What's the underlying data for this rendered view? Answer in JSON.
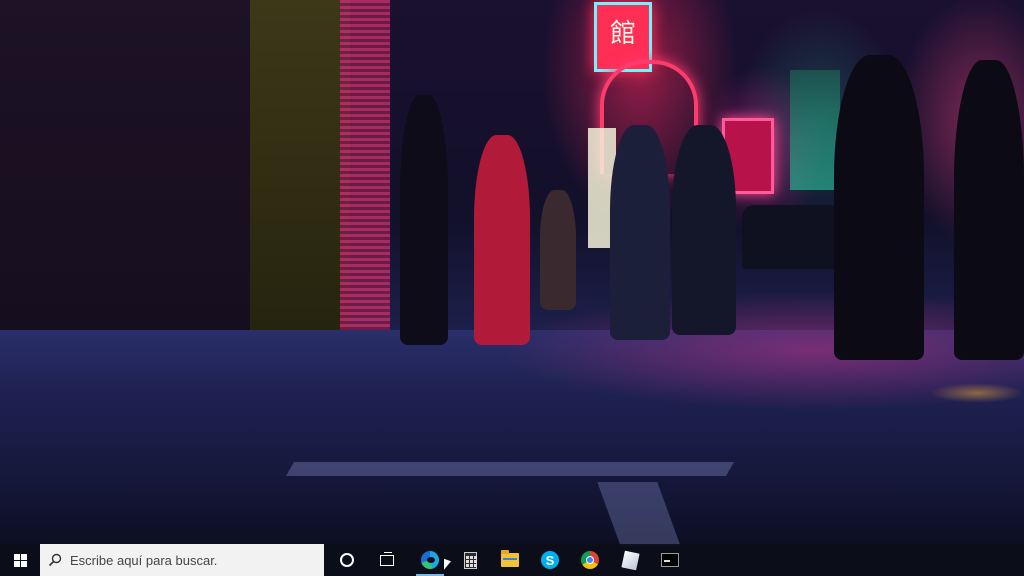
{
  "desktop": {
    "wallpaper": "neon-night-street",
    "sign_text": "館"
  },
  "taskbar": {
    "search": {
      "placeholder": "Escribe aquí para buscar."
    },
    "pinned_apps": [
      {
        "name": "cortana",
        "icon": "cortana-circle-icon"
      },
      {
        "name": "task-view",
        "icon": "task-view-icon"
      },
      {
        "name": "edge",
        "icon": "edge-icon",
        "active": true
      },
      {
        "name": "calculator",
        "icon": "calculator-icon"
      },
      {
        "name": "file-explorer",
        "icon": "folder-icon"
      },
      {
        "name": "skype",
        "icon": "skype-icon",
        "glyph": "S"
      },
      {
        "name": "chrome",
        "icon": "chrome-icon"
      },
      {
        "name": "notes",
        "icon": "note-icon"
      },
      {
        "name": "command-prompt",
        "icon": "terminal-icon"
      }
    ],
    "colors": {
      "accent": "#76b9ed",
      "background": "#0c0e1a"
    }
  }
}
